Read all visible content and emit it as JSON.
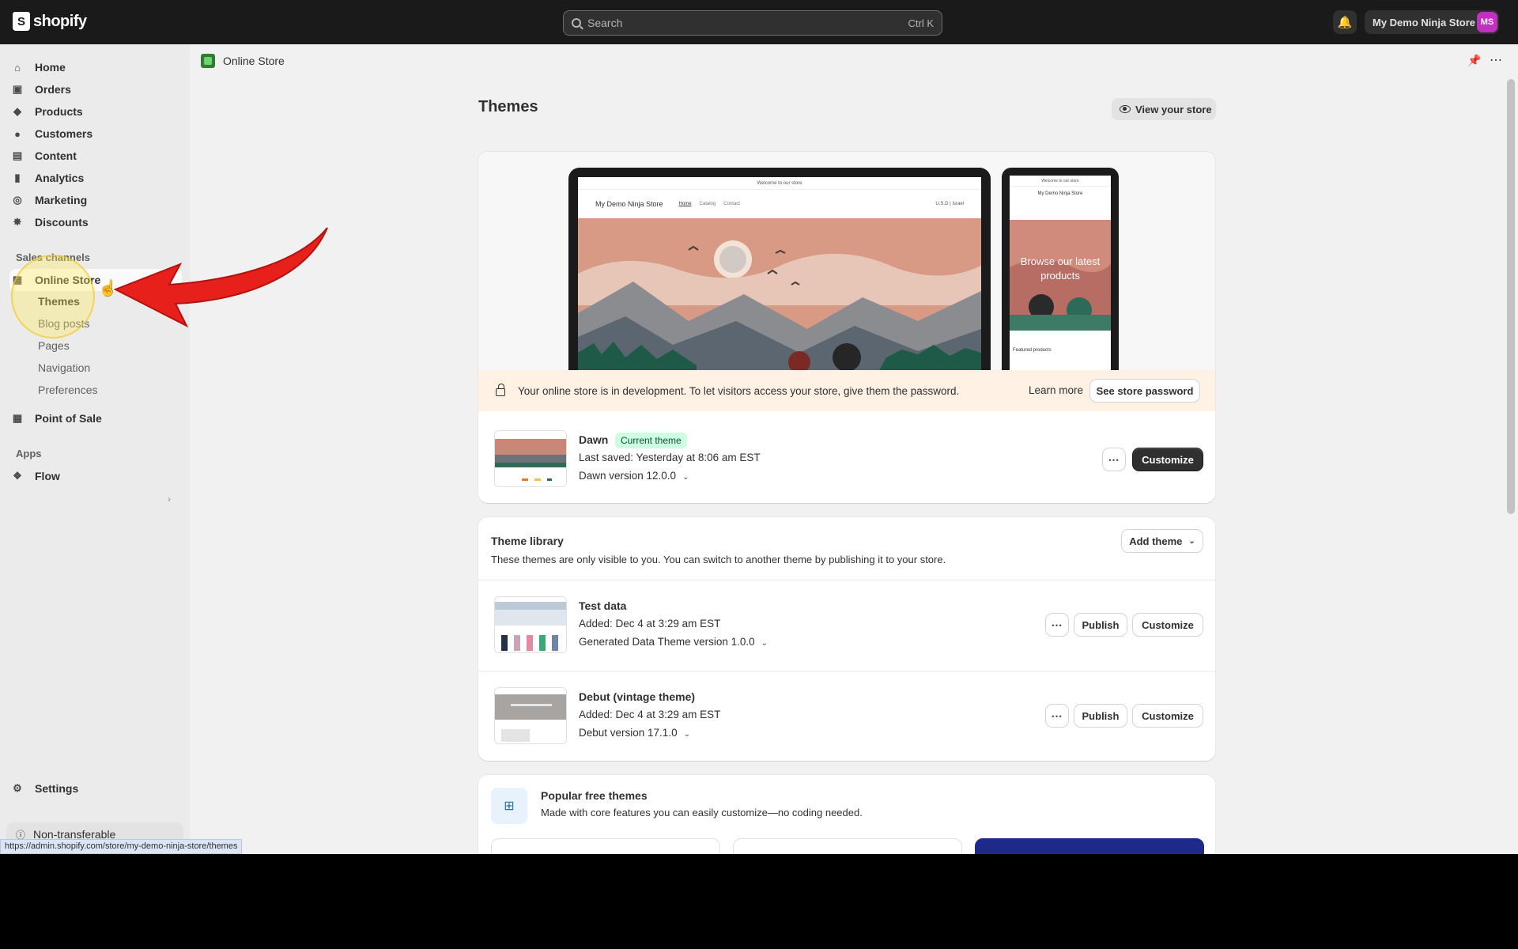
{
  "topbar": {
    "logo_text": "shopify",
    "search_placeholder": "Search",
    "search_shortcut": "Ctrl K",
    "store_name": "My Demo Ninja Store",
    "avatar_initials": "MS"
  },
  "sidebar": {
    "items": [
      {
        "label": "Home",
        "icon": "home-icon"
      },
      {
        "label": "Orders",
        "icon": "orders-icon"
      },
      {
        "label": "Products",
        "icon": "tag-icon"
      },
      {
        "label": "Customers",
        "icon": "person-icon"
      },
      {
        "label": "Content",
        "icon": "content-icon"
      },
      {
        "label": "Analytics",
        "icon": "bar-chart-icon"
      },
      {
        "label": "Marketing",
        "icon": "target-icon"
      },
      {
        "label": "Discounts",
        "icon": "discount-icon"
      }
    ],
    "sales_channels_label": "Sales channels",
    "online_store": "Online Store",
    "online_store_sub": [
      "Themes",
      "Blog posts",
      "Pages",
      "Navigation",
      "Preferences"
    ],
    "point_of_sale": "Point of Sale",
    "apps_label": "Apps",
    "flow": "Flow",
    "settings": "Settings",
    "non_transferable": "Non-transferable"
  },
  "status_url": "https://admin.shopify.com/store/my-demo-ninja-store/themes",
  "breadcrumb": "Online Store",
  "page": {
    "title": "Themes",
    "view_store_label": "View your store"
  },
  "preview": {
    "announcement": "Welcome to our store",
    "store_name": "My Demo Ninja Store",
    "nav_links": [
      "Home",
      "Catalog",
      "Contact"
    ],
    "currency": "U.S.D | Israel",
    "phone_store_name": "My Demo Ninja Store",
    "phone_hero_text": "Browse our latest products",
    "phone_featured": "Featured products"
  },
  "dev_banner": {
    "message": "Your online store is in development. To let visitors access your store, give them the password.",
    "learn_more": "Learn more",
    "button": "See store password"
  },
  "current_theme": {
    "name": "Dawn",
    "badge": "Current theme",
    "saved": "Last saved: Yesterday at 8:06 am EST",
    "version": "Dawn version 12.0.0",
    "customize": "Customize"
  },
  "library": {
    "title": "Theme library",
    "add_theme": "Add theme",
    "description": "These themes are only visible to you. You can switch to another theme by publishing it to your store.",
    "themes": [
      {
        "name": "Test data",
        "added": "Added: Dec 4 at 3:29 am EST",
        "version": "Generated Data Theme version 1.0.0",
        "publish": "Publish",
        "customize": "Customize"
      },
      {
        "name": "Debut (vintage theme)",
        "added": "Added: Dec 4 at 3:29 am EST",
        "version": "Debut version 17.1.0",
        "publish": "Publish",
        "customize": "Customize"
      }
    ]
  },
  "popular": {
    "title": "Popular free themes",
    "subtitle": "Made with core features you can easily customize—no coding needed."
  },
  "colors": {
    "topbar": "#1a1a1a",
    "accent_avatar": "#c031c0",
    "badge_green": "#cdfee1",
    "banner_orange": "#fff1e4",
    "arrow_red": "#e8201c"
  }
}
